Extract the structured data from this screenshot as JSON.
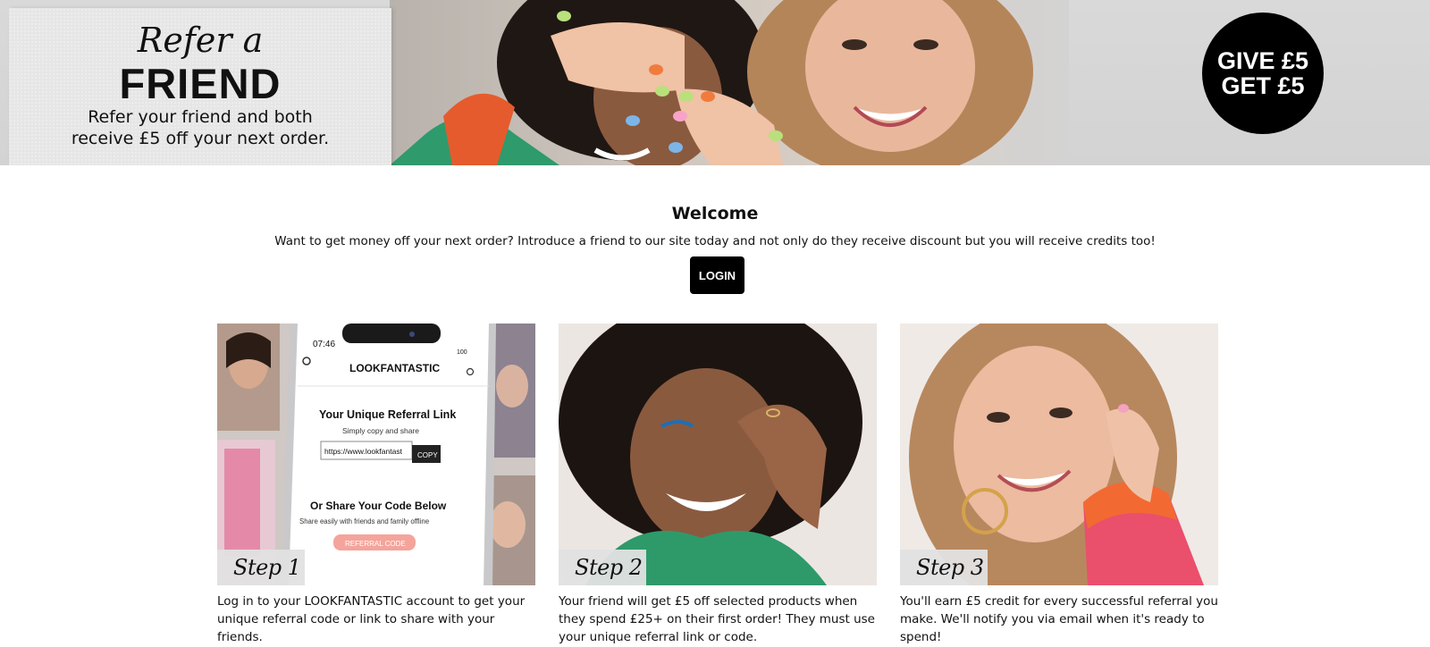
{
  "hero": {
    "title_line1": "Refer a",
    "title_line2": "FRIEND",
    "subtitle_line1": "Refer your friend and both",
    "subtitle_line2": "receive £5 off your next order.",
    "badge_line1": "GIVE £5",
    "badge_line2": "GET £5"
  },
  "welcome": {
    "title": "Welcome",
    "text": "Want to get money off your next order? Introduce a friend to our site today and not only do they receive discount but you will receive credits too!",
    "login_label": "LOGIN"
  },
  "steps": [
    {
      "tag": "Step 1",
      "text": "Log in to your LOOKFANTASTIC account to get your unique referral code or link to share with your friends.",
      "phone": {
        "time": "07:46",
        "battery": "100",
        "brand": "LOOKFANTASTIC",
        "heading": "Your Unique Referral Link",
        "sub": "Simply copy and share",
        "link": "https://www.lookfantast",
        "copy_label": "COPY",
        "share_heading": "Or Share Your Code Below",
        "share_sub": "Share easily with friends and family offline",
        "code_label": "REFERRAL CODE"
      }
    },
    {
      "tag": "Step 2",
      "text": "Your friend will get £5 off selected products when they spend £25+ on their first order! They must use your unique referral link or code."
    },
    {
      "tag": "Step 3",
      "text": "You'll earn £5 credit for every successful referral you make. We'll notify you via email when it's ready to spend!"
    }
  ],
  "colors": {
    "button_bg": "#000000",
    "badge_bg": "#000000",
    "referral_code_pink": "#f4a49b",
    "hero_bg": "#d6d6d6"
  }
}
